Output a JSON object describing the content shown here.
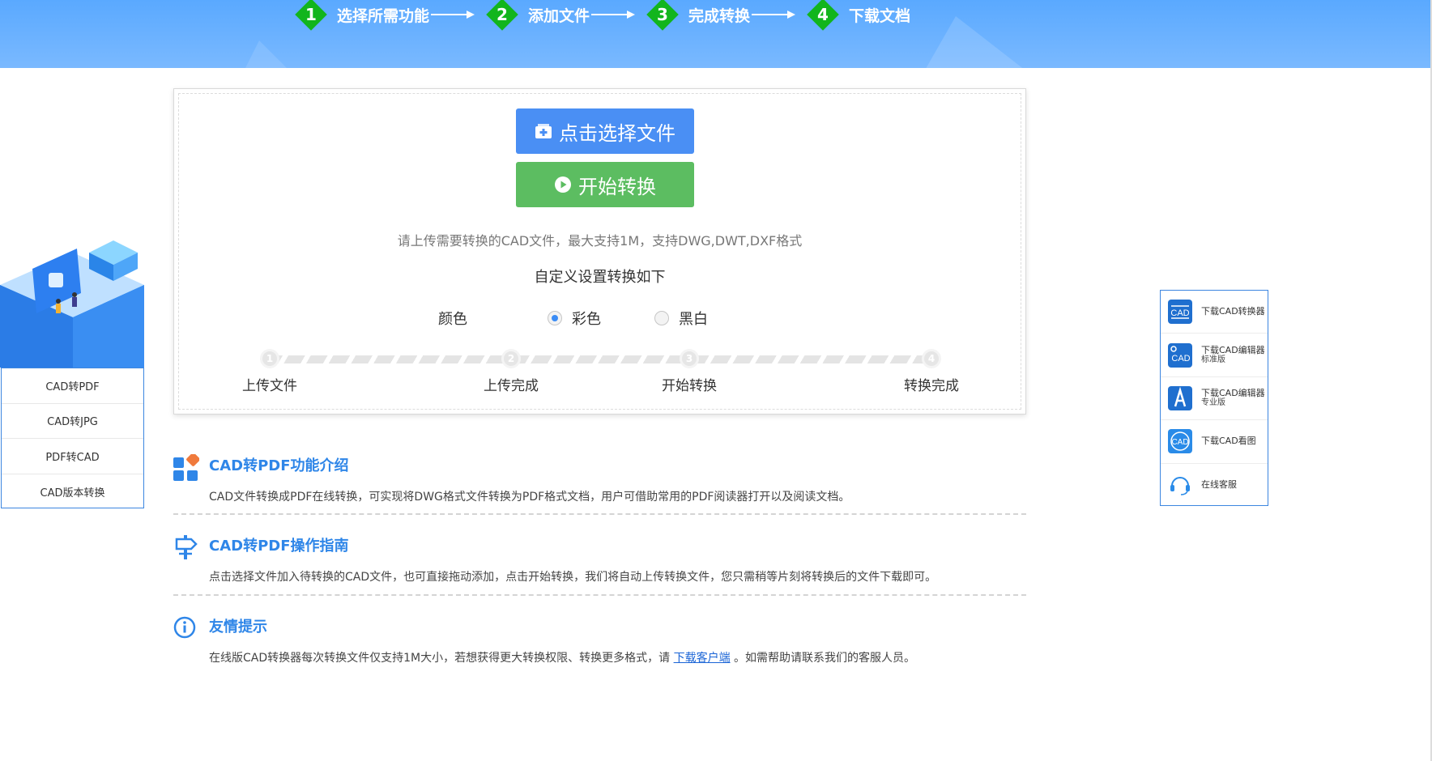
{
  "banner": {
    "steps": [
      {
        "num": "1",
        "label": "选择所需功能"
      },
      {
        "num": "2",
        "label": "添加文件"
      },
      {
        "num": "3",
        "label": "完成转换"
      },
      {
        "num": "4",
        "label": "下载文档"
      }
    ]
  },
  "upload": {
    "select_button": "点击选择文件",
    "start_button": "开始转换",
    "hint": "请上传需要转换的CAD文件，最大支持1M，支持DWG,DWT,DXF格式",
    "custom_title": "自定义设置转换如下",
    "color_label": "颜色",
    "color_options": [
      {
        "label": "彩色",
        "selected": true
      },
      {
        "label": "黑白",
        "selected": false
      }
    ],
    "progress_steps": [
      {
        "num": "1",
        "label": "上传文件"
      },
      {
        "num": "2",
        "label": "上传完成"
      },
      {
        "num": "3",
        "label": "开始转换"
      },
      {
        "num": "4",
        "label": "转换完成"
      }
    ]
  },
  "left_menu": {
    "items": [
      "CAD转PDF",
      "CAD转JPG",
      "PDF转CAD",
      "CAD版本转换"
    ]
  },
  "sections": {
    "intro": {
      "title": "CAD转PDF功能介绍",
      "text": "CAD文件转换成PDF在线转换，可实现将DWG格式文件转换为PDF格式文档，用户可借助常用的PDF阅读器打开以及阅读文档。"
    },
    "guide": {
      "title": "CAD转PDF操作指南",
      "text": "点击选择文件加入待转换的CAD文件，也可直接拖动添加，点击开始转换，我们将自动上传转换文件，您只需稍等片刻将转换后的文件下载即可。"
    },
    "tips": {
      "title": "友情提示",
      "text_before": "在线版CAD转换器每次转换文件仅支持1M大小，若想获得更大转换权限、转换更多格式，请 ",
      "link": "下载客户端",
      "text_after": " 。如需帮助请联系我们的客服人员。"
    }
  },
  "right_panel": {
    "items": [
      {
        "label": "下载CAD转换器",
        "sub": "",
        "icon": "cad-converter-icon"
      },
      {
        "label": "下载CAD编辑器",
        "sub": "标准版",
        "icon": "cad-editor-standard-icon"
      },
      {
        "label": "下载CAD编辑器",
        "sub": "专业版",
        "icon": "cad-editor-pro-icon"
      },
      {
        "label": "下载CAD看图",
        "sub": "",
        "icon": "cad-viewer-icon"
      },
      {
        "label": "在线客服",
        "sub": "",
        "icon": "headset-icon"
      }
    ],
    "icon_text": "CAD"
  },
  "colors": {
    "accent_blue": "#4a8ff4",
    "start_green": "#5cbd61",
    "step_green": "#12b51d",
    "title_blue": "#2f86e8"
  }
}
